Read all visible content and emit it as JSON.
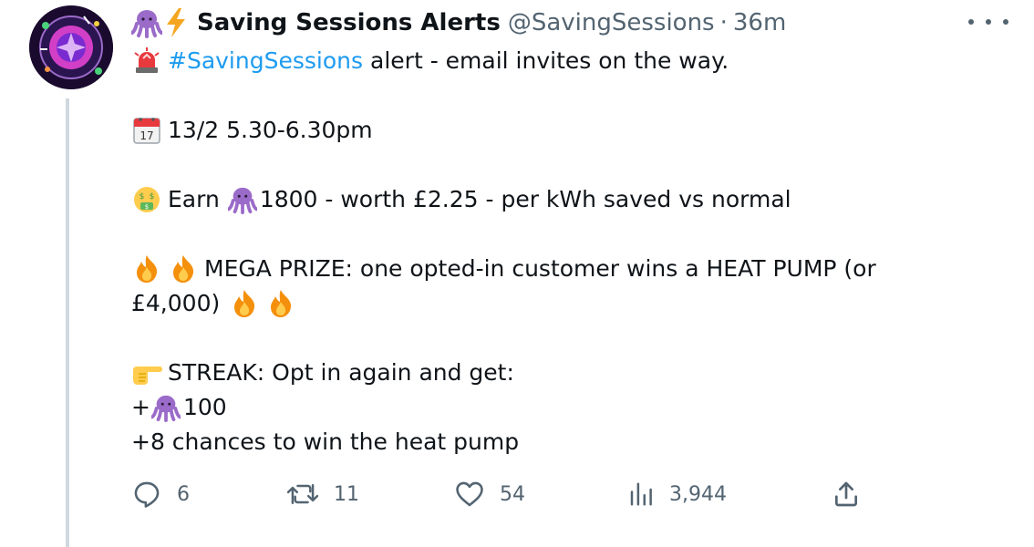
{
  "tweet": {
    "display_name": "Saving Sessions Alerts",
    "handle": "@SavingSessions",
    "separator": "·",
    "time": "36m",
    "header_emojis": [
      "octopus-icon",
      "lightning-icon"
    ],
    "lines": {
      "l1_hashtag": "#SavingSessions",
      "l1_rest": "alert - email invites on the way.",
      "l2": "13/2 5.30-6.30pm",
      "l3_a": "Earn",
      "l3_b": "1800 - worth £2.25 - per kWh saved vs normal",
      "l4": "MEGA PRIZE: one opted-in customer wins a HEAT PUMP (or",
      "l5": "£4,000)",
      "l6": "STREAK: Opt in again and get:",
      "l7_a": "+",
      "l7_b": "100",
      "l8": "+8 chances to win the heat pump"
    }
  },
  "actions": {
    "reply_count": "6",
    "retweet_count": "11",
    "like_count": "54",
    "views_count": "3,944"
  },
  "colors": {
    "text": "#0f1419",
    "secondary": "#536471",
    "link": "#1d9bf0",
    "thread_line": "#cfd9de",
    "octopus": "#9b6bc9"
  }
}
